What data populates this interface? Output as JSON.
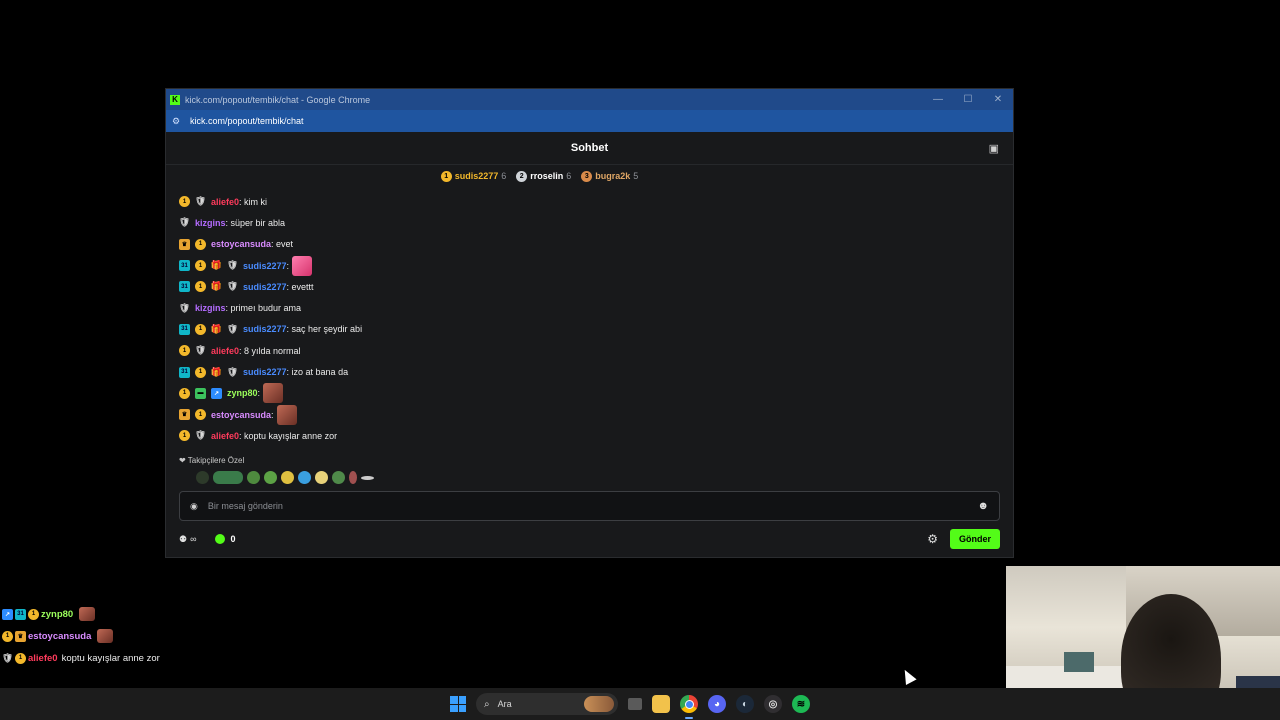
{
  "window": {
    "title": "kick.com/popout/tembik/chat - Google Chrome",
    "url": "kick.com/popout/tembik/chat",
    "logo_letter": "K"
  },
  "chat": {
    "title": "Sohbet",
    "leaderboard": [
      {
        "rank": "1",
        "name": "sudis2277",
        "count": "6",
        "color": "#f3b82b"
      },
      {
        "rank": "2",
        "name": "rroselin",
        "count": "6",
        "color": "#ffffff"
      },
      {
        "rank": "3",
        "name": "bugra2k",
        "count": "5",
        "color": "#e0a766"
      }
    ],
    "messages": [
      {
        "badges": [
          "gold",
          "mod"
        ],
        "user": "aliefe0",
        "color": "#ff3b5c",
        "text": ": kim ki"
      },
      {
        "badges": [
          "mod"
        ],
        "user": "kizgins",
        "color": "#b46cff",
        "text": ": süper bir abla"
      },
      {
        "badges": [
          "vip",
          "gold"
        ],
        "user": "estoycansuda",
        "color": "#d98cff",
        "text": ": evet"
      },
      {
        "badges": [
          "sub",
          "gold",
          "gift",
          "mod"
        ],
        "user": "sudis2277",
        "color": "#4a8cff",
        "text": ":",
        "emote": "pink"
      },
      {
        "badges": [
          "sub",
          "gold",
          "gift",
          "mod"
        ],
        "user": "sudis2277",
        "color": "#4a8cff",
        "text": ": evettt"
      },
      {
        "badges": [
          "mod"
        ],
        "user": "kizgins",
        "color": "#b46cff",
        "text": ": primeı budur ama"
      },
      {
        "badges": [
          "sub",
          "gold",
          "gift",
          "mod"
        ],
        "user": "sudis2277",
        "color": "#4a8cff",
        "text": ": saç her şeydir abi"
      },
      {
        "badges": [
          "gold",
          "mod"
        ],
        "user": "aliefe0",
        "color": "#ff3b5c",
        "text": ": 8 yılda normal"
      },
      {
        "badges": [
          "sub",
          "gold",
          "gift",
          "mod"
        ],
        "user": "sudis2277",
        "color": "#4a8cff",
        "text": ": izo at bana da"
      },
      {
        "badges": [
          "gold",
          "green",
          "og"
        ],
        "user": "zynp80",
        "color": "#9cff5c",
        "text": ":",
        "emote": "face"
      },
      {
        "badges": [
          "vip",
          "gold"
        ],
        "user": "estoycansuda",
        "color": "#d98cff",
        "text": ":",
        "emote": "face"
      },
      {
        "badges": [
          "gold",
          "mod"
        ],
        "user": "aliefe0",
        "color": "#ff3b5c",
        "text": ": koptu kayışlar anne zor"
      }
    ],
    "follow_only_label": "❤ Takipçilere Özel",
    "input_placeholder": "Bir mesaj gönderin",
    "points_value": "0",
    "infinity": "∞",
    "send_label": "Gönder"
  },
  "overlay": [
    {
      "badges": [
        "og",
        "sub",
        "gold"
      ],
      "user": "zynp80",
      "color": "#9cff5c",
      "text": "",
      "emote": "face"
    },
    {
      "badges": [
        "gold",
        "vip"
      ],
      "user": "estoycansuda",
      "color": "#d98cff",
      "text": "",
      "emote": "face"
    },
    {
      "badges": [
        "mod",
        "gold"
      ],
      "user": "aliefe0",
      "color": "#ff3b5c",
      "text": "koptu kayışlar anne zor"
    }
  ],
  "taskbar": {
    "search_placeholder": "Ara",
    "apps": [
      "windows-start",
      "search",
      "task-view",
      "file-explorer",
      "chrome",
      "discord",
      "steam",
      "obs",
      "spotify"
    ]
  },
  "badge_glyphs": {
    "gold": "1",
    "sub": "31",
    "gift": "🎁",
    "mod": "🛡",
    "vip": "♛",
    "green": "▬",
    "og": "↗"
  }
}
